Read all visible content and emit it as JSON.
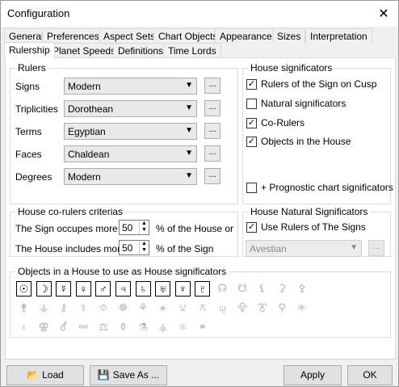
{
  "window": {
    "title": "Configuration",
    "close_glyph": "✕"
  },
  "tabs_row1": [
    "General",
    "Preferences",
    "Aspect Sets",
    "Chart Objects",
    "Appearance",
    "Sizes",
    "Interpretation"
  ],
  "tabs_row2": [
    "Rulership",
    "Planet Speeds",
    "Definitions",
    "Time Lords"
  ],
  "rulers": {
    "legend": "Rulers",
    "rows": [
      {
        "label": "Signs",
        "value": "Modern"
      },
      {
        "label": "Triplicities",
        "value": "Dorothean"
      },
      {
        "label": "Terms",
        "value": "Egyptian"
      },
      {
        "label": "Faces",
        "value": "Chaldean"
      },
      {
        "label": "Degrees",
        "value": "Modern"
      }
    ],
    "dots": "..."
  },
  "house_sig": {
    "legend": "House significators",
    "items": [
      {
        "label": "Rulers of the Sign on Cusp",
        "checked": true
      },
      {
        "label": "Natural significators",
        "checked": false
      },
      {
        "label": "Co-Rulers",
        "checked": true
      },
      {
        "label": "Objects in the House",
        "checked": true
      }
    ],
    "prognostic": {
      "label": "+ Prognostic chart significators",
      "checked": false
    }
  },
  "corulers": {
    "legend": "House co-rulers criterias",
    "sign_label": "The Sign occupes more",
    "sign_value": "50",
    "sign_suffix": "% of the House or",
    "house_label": "The House includes more",
    "house_value": "50",
    "house_suffix": "% of the Sign"
  },
  "natural": {
    "legend": "House Natural Significators",
    "use_label": "Use Rulers of The Signs",
    "use_checked": true,
    "combo": "Avestian",
    "dots": "..."
  },
  "objects": {
    "legend": "Objects in a House to use as House significators",
    "rows": [
      [
        {
          "g": "☉",
          "on": true
        },
        {
          "g": "☽",
          "on": true
        },
        {
          "g": "☿",
          "on": true
        },
        {
          "g": "♀",
          "on": true
        },
        {
          "g": "♂",
          "on": true
        },
        {
          "g": "♃",
          "on": true
        },
        {
          "g": "♄",
          "on": true
        },
        {
          "g": "♅",
          "on": true
        },
        {
          "g": "♆",
          "on": true
        },
        {
          "g": "♇",
          "on": true
        },
        {
          "g": "☊",
          "on": false
        },
        {
          "g": "☋",
          "on": false
        },
        {
          "g": "⚸",
          "on": false
        },
        {
          "g": "⚳",
          "on": false
        },
        {
          "g": "⚴",
          "on": false
        }
      ],
      [
        {
          "g": "⚵",
          "on": false
        },
        {
          "g": "⚶",
          "on": false
        },
        {
          "g": "⚷",
          "on": false
        },
        {
          "g": "⚕",
          "on": false
        },
        {
          "g": "⯑",
          "on": false
        },
        {
          "g": "☸",
          "on": false
        },
        {
          "g": "⚘",
          "on": false
        },
        {
          "g": "⚹",
          "on": false
        },
        {
          "g": "⚺",
          "on": false
        },
        {
          "g": "⚻",
          "on": false
        },
        {
          "g": "⚼",
          "on": false
        },
        {
          "g": "⯓",
          "on": false
        },
        {
          "g": "⯔",
          "on": false
        },
        {
          "g": "⚲",
          "on": false
        },
        {
          "g": "✳",
          "on": false
        }
      ],
      [
        {
          "g": "♁",
          "on": false
        },
        {
          "g": "⚢",
          "on": false
        },
        {
          "g": "⚦",
          "on": false
        },
        {
          "g": "⚯",
          "on": false
        },
        {
          "g": "⚖",
          "on": false
        },
        {
          "g": "⚱",
          "on": false
        },
        {
          "g": "⚗",
          "on": false
        },
        {
          "g": "⚶",
          "on": false
        },
        {
          "g": "⚛",
          "on": false
        },
        {
          "g": "⚭",
          "on": false
        }
      ]
    ]
  },
  "buttons": {
    "load": "Load",
    "save": "Save As ...",
    "apply": "Apply",
    "ok": "OK"
  }
}
